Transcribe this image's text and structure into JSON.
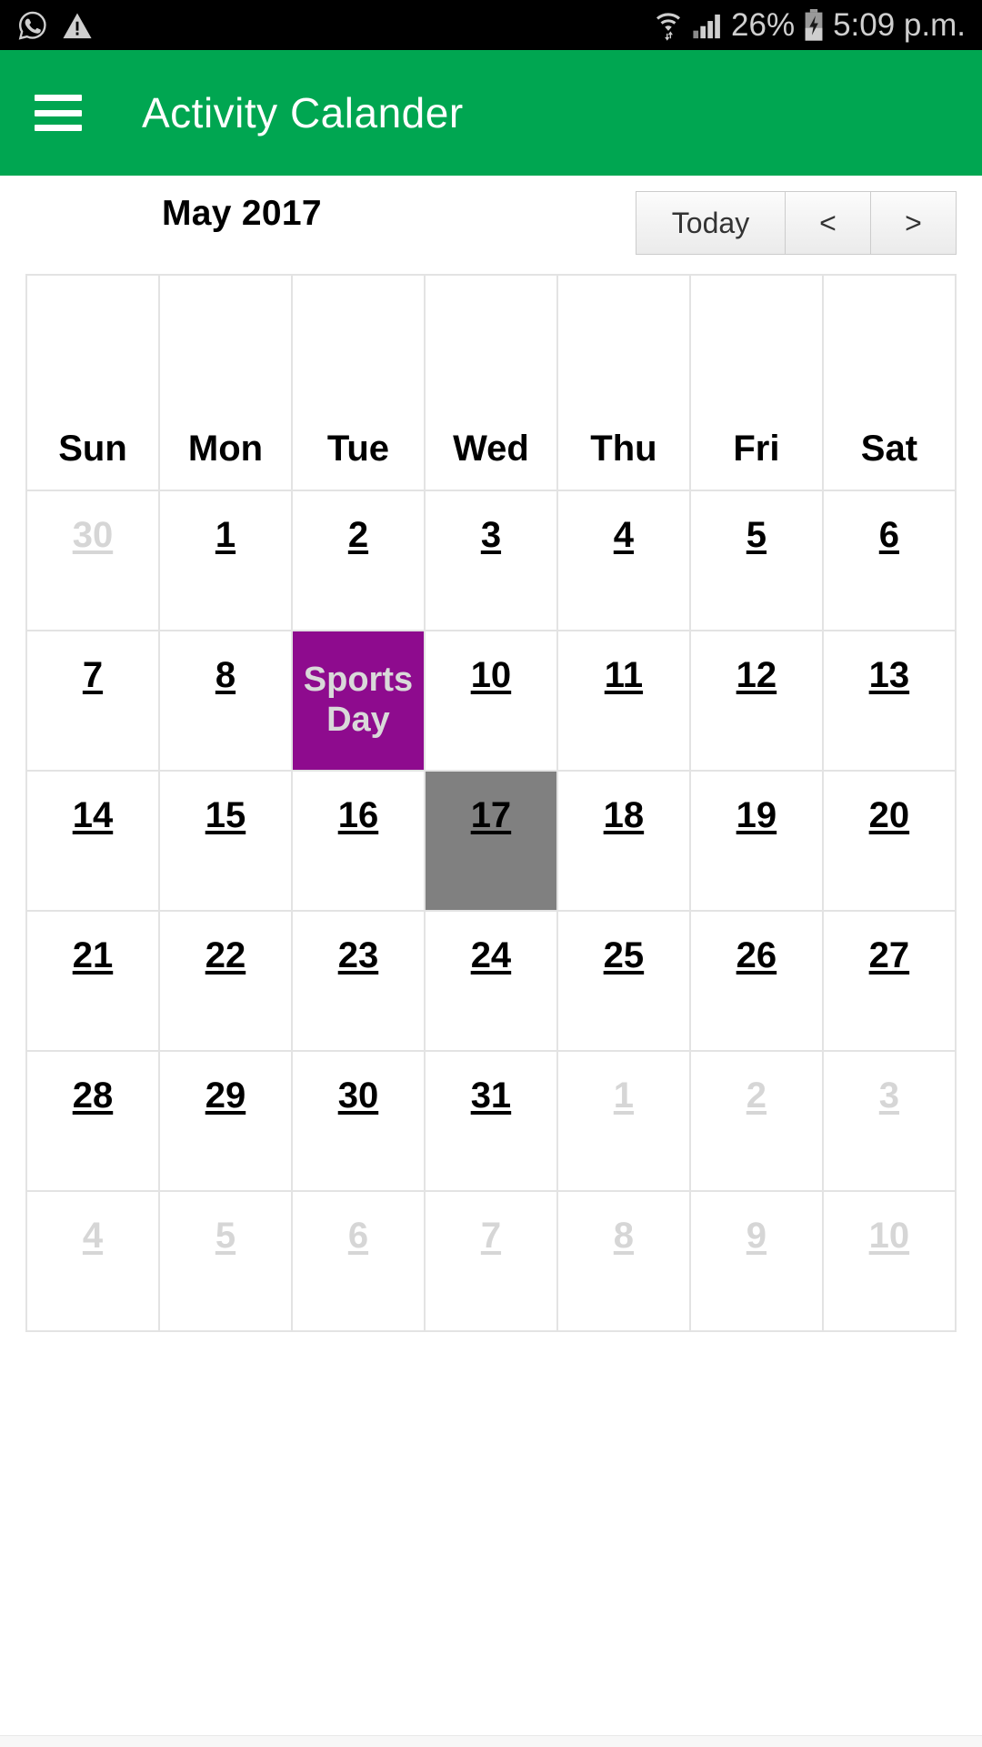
{
  "statusbar": {
    "left_icons": [
      {
        "name": "whatsapp-icon",
        "label": "WhatsApp"
      },
      {
        "name": "warning-triangle-icon",
        "label": "Warning"
      }
    ],
    "right_icons": [
      {
        "name": "wifi-icon",
        "label": "Wi-Fi"
      },
      {
        "name": "signal-bars-icon",
        "label": "Signal"
      },
      {
        "name": "battery-charging-icon",
        "label": "Battery charging"
      }
    ],
    "battery_percent": "26%",
    "clock": "5:09 p.m."
  },
  "appbar": {
    "menu_icon": "hamburger-menu-icon",
    "title": "Activity Calander",
    "background_color": "#00a651"
  },
  "calendar": {
    "month_title": "May 2017",
    "buttons": {
      "today": "Today",
      "prev": "<",
      "next": ">"
    },
    "weekdays": [
      "Sun",
      "Mon",
      "Tue",
      "Wed",
      "Thu",
      "Fri",
      "Sat"
    ],
    "colors": {
      "today_highlight": "#808080",
      "event_background": "#8e0b8e",
      "event_text": "#d9d9d9",
      "muted_day": "#d6d6d6",
      "grid_border": "#e3e3e3"
    },
    "weeks": [
      [
        {
          "label": "30",
          "muted": true
        },
        {
          "label": "1",
          "muted": false
        },
        {
          "label": "2",
          "muted": false
        },
        {
          "label": "3",
          "muted": false
        },
        {
          "label": "4",
          "muted": false
        },
        {
          "label": "5",
          "muted": false
        },
        {
          "label": "6",
          "muted": false
        }
      ],
      [
        {
          "label": "7",
          "muted": false
        },
        {
          "label": "8",
          "muted": false
        },
        {
          "label": "Sports Day",
          "muted": false,
          "event": true
        },
        {
          "label": "10",
          "muted": false
        },
        {
          "label": "11",
          "muted": false
        },
        {
          "label": "12",
          "muted": false
        },
        {
          "label": "13",
          "muted": false
        }
      ],
      [
        {
          "label": "14",
          "muted": false
        },
        {
          "label": "15",
          "muted": false
        },
        {
          "label": "16",
          "muted": false
        },
        {
          "label": "17",
          "muted": false,
          "today": true
        },
        {
          "label": "18",
          "muted": false
        },
        {
          "label": "19",
          "muted": false
        },
        {
          "label": "20",
          "muted": false
        }
      ],
      [
        {
          "label": "21",
          "muted": false
        },
        {
          "label": "22",
          "muted": false
        },
        {
          "label": "23",
          "muted": false
        },
        {
          "label": "24",
          "muted": false
        },
        {
          "label": "25",
          "muted": false
        },
        {
          "label": "26",
          "muted": false
        },
        {
          "label": "27",
          "muted": false
        }
      ],
      [
        {
          "label": "28",
          "muted": false
        },
        {
          "label": "29",
          "muted": false
        },
        {
          "label": "30",
          "muted": false
        },
        {
          "label": "31",
          "muted": false
        },
        {
          "label": "1",
          "muted": true
        },
        {
          "label": "2",
          "muted": true
        },
        {
          "label": "3",
          "muted": true
        }
      ],
      [
        {
          "label": "4",
          "muted": true
        },
        {
          "label": "5",
          "muted": true
        },
        {
          "label": "6",
          "muted": true
        },
        {
          "label": "7",
          "muted": true
        },
        {
          "label": "8",
          "muted": true
        },
        {
          "label": "9",
          "muted": true
        },
        {
          "label": "10",
          "muted": true
        }
      ]
    ]
  }
}
